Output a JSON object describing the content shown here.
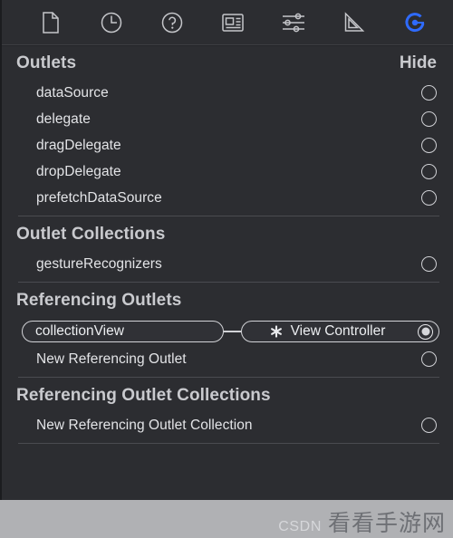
{
  "toolbar": {
    "icons": [
      {
        "name": "file-inspector-icon",
        "glyph": "document",
        "active": false
      },
      {
        "name": "history-inspector-icon",
        "glyph": "clock",
        "active": false
      },
      {
        "name": "help-inspector-icon",
        "glyph": "question",
        "active": false
      },
      {
        "name": "identity-inspector-icon",
        "glyph": "card",
        "active": false
      },
      {
        "name": "attributes-inspector-icon",
        "glyph": "sliders",
        "active": false
      },
      {
        "name": "size-inspector-icon",
        "glyph": "ruler",
        "active": false
      },
      {
        "name": "connections-inspector-icon",
        "glyph": "connection",
        "active": true
      }
    ]
  },
  "sections": [
    {
      "title": "Outlets",
      "action": "Hide",
      "rows": [
        {
          "label": "dataSource",
          "connected": false
        },
        {
          "label": "delegate",
          "connected": false
        },
        {
          "label": "dragDelegate",
          "connected": false
        },
        {
          "label": "dropDelegate",
          "connected": false
        },
        {
          "label": "prefetchDataSource",
          "connected": false
        }
      ]
    },
    {
      "title": "Outlet Collections",
      "action": "",
      "rows": [
        {
          "label": "gestureRecognizers",
          "connected": false
        }
      ]
    },
    {
      "title": "Referencing Outlets",
      "action": "",
      "connection": {
        "outlet_name": "collectionView",
        "target_label": "View Controller",
        "disconnect_icon": "disconnect-x-icon",
        "connected": true
      },
      "rows": [
        {
          "label": "New Referencing Outlet",
          "connected": false
        }
      ]
    },
    {
      "title": "Referencing Outlet Collections",
      "action": "",
      "rows": [
        {
          "label": "New Referencing Outlet Collection",
          "connected": false
        }
      ]
    }
  ],
  "watermark": {
    "brand": "CSDN",
    "site": "看看手游网"
  }
}
